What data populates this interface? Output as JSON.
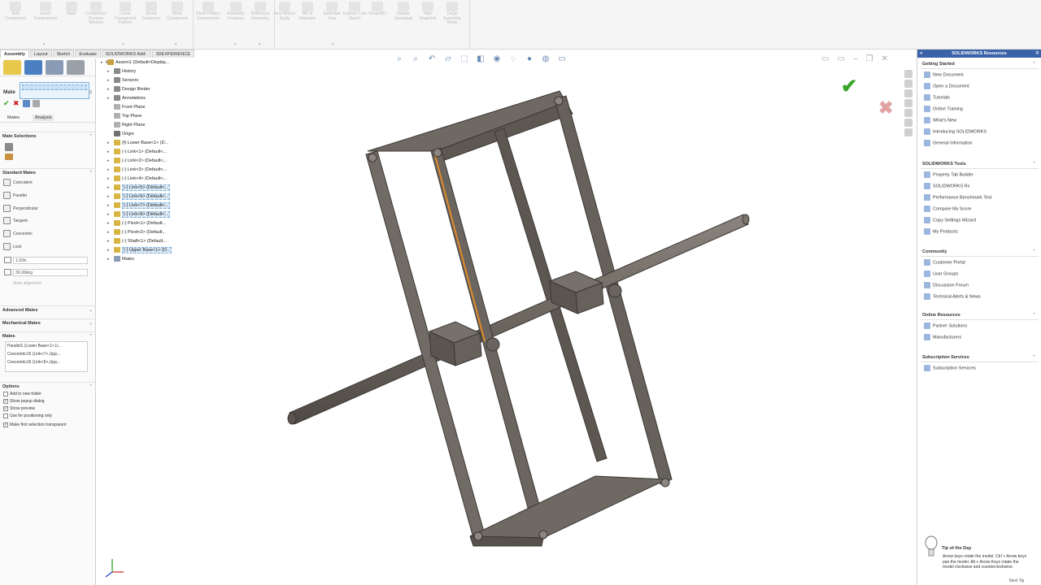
{
  "ribbon": {
    "buttons": [
      "Edit Component",
      "Insert Components",
      "Mate",
      "Component Preview Window",
      "Linear Component Pattern",
      "Smart Fasteners",
      "Move Component",
      "Show Hidden Components",
      "Assembly Features",
      "Reference Geometry",
      "New Motion Study",
      "Bill of Materials",
      "Exploded View",
      "Explode Line Sketch",
      "Instant3D",
      "Update Speedpak",
      "Take Snapshot",
      "Large Assembly Mode"
    ]
  },
  "tabs": [
    "Assembly",
    "Layout",
    "Sketch",
    "Evaluate",
    "SOLIDWORKS Add-Ins",
    "3DEXPERIENCE"
  ],
  "property_manager": {
    "title": "Mate",
    "subtabs": [
      "Mates",
      "Analysis"
    ],
    "sections": {
      "mate_selections": "Mate Selections",
      "standard_mates": "Standard Mates",
      "advanced_mates": "Advanced Mates",
      "mechanical_mates": "Mechanical Mates",
      "mates": "Mates",
      "options": "Options"
    },
    "standard_mates": [
      "Coincident",
      "Parallel",
      "Perpendicular",
      "Tangent",
      "Concentric",
      "Lock"
    ],
    "distance_value": "1.00in",
    "angle_value": "30.00deg",
    "mate_alignment": "Mate alignment:",
    "mates_list": [
      "Parallel1 (Lower Base<1>,U...",
      "Concentric15 (Link<7>,Upp...",
      "Concentric16 (Link<5>,Upp..."
    ],
    "options": [
      {
        "label": "Add to new folder",
        "checked": false
      },
      {
        "label": "Show popup dialog",
        "checked": true
      },
      {
        "label": "Show preview",
        "checked": true
      },
      {
        "label": "Use for positioning only",
        "checked": false
      },
      {
        "label": "Make first selection transparent",
        "checked": true
      }
    ]
  },
  "tree": {
    "items": [
      {
        "label": "Assem1 (Default<Display...",
        "sel": false
      },
      {
        "label": "History",
        "sel": false
      },
      {
        "label": "Sensors",
        "sel": false
      },
      {
        "label": "Design Binder",
        "sel": false
      },
      {
        "label": "Annotations",
        "sel": false
      },
      {
        "label": "Front Plane",
        "sel": false
      },
      {
        "label": "Top Plane",
        "sel": false
      },
      {
        "label": "Right Plane",
        "sel": false
      },
      {
        "label": "Origin",
        "sel": false
      },
      {
        "label": "(f) Lower Base<1> (D...",
        "sel": false
      },
      {
        "label": "(-) Link<1> (Default<...",
        "sel": false
      },
      {
        "label": "(-) Link<2> (Default<...",
        "sel": false
      },
      {
        "label": "(-) Link<3> (Default<...",
        "sel": false
      },
      {
        "label": "(-) Link<4> (Default<...",
        "sel": false
      },
      {
        "label": "(-) Link<5> (Default<...",
        "sel": true
      },
      {
        "label": "(-) Link<6> (Default<...",
        "sel": true
      },
      {
        "label": "(-) Link<7> (Default<...",
        "sel": true
      },
      {
        "label": "(-) Link<8> (Default<...",
        "sel": true
      },
      {
        "label": "(-) Pivot<1> (Default...",
        "sel": false
      },
      {
        "label": "(-) Pivot<2> (Default...",
        "sel": false
      },
      {
        "label": "(-) Shaft<1> (Default...",
        "sel": false
      },
      {
        "label": "(-) Upper Base<1> (D...",
        "sel": true
      },
      {
        "label": "Mates",
        "sel": false
      }
    ]
  },
  "resources": {
    "title": "SOLIDWORKS Resources",
    "sections": [
      {
        "title": "Getting Started",
        "links": [
          "New Document",
          "Open a Document",
          "Tutorials",
          "Online Training",
          "What's New",
          "Introducing SOLIDWORKS",
          "General Information"
        ]
      },
      {
        "title": "SOLIDWORKS Tools",
        "links": [
          "Property Tab Builder",
          "SOLIDWORKS Rx",
          "Performance Benchmark Test",
          "Compare My Score",
          "Copy Settings Wizard",
          "My Products"
        ]
      },
      {
        "title": "Community",
        "links": [
          "Customer Portal",
          "User Groups",
          "Discussion Forum",
          "Technical Alerts & News"
        ]
      },
      {
        "title": "Online Resources",
        "links": [
          "Partner Solutions",
          "Manufacturers"
        ]
      },
      {
        "title": "Subscription Services",
        "links": [
          "Subscription Services"
        ]
      }
    ],
    "tip_title": "Tip of the Day",
    "tip_text": "Arrow keys rotate the model. Ctrl + Arrow keys pan the model. Alt + Arrow Keys rotate the model clockwise and counterclockwise.",
    "next_tip": "Next Tip"
  },
  "colors": {
    "accent": "#3a62a8",
    "ok": "#3aa42a",
    "cancel": "#c62020",
    "part": "#6e6862",
    "selection_edge": "#e08a2a"
  }
}
